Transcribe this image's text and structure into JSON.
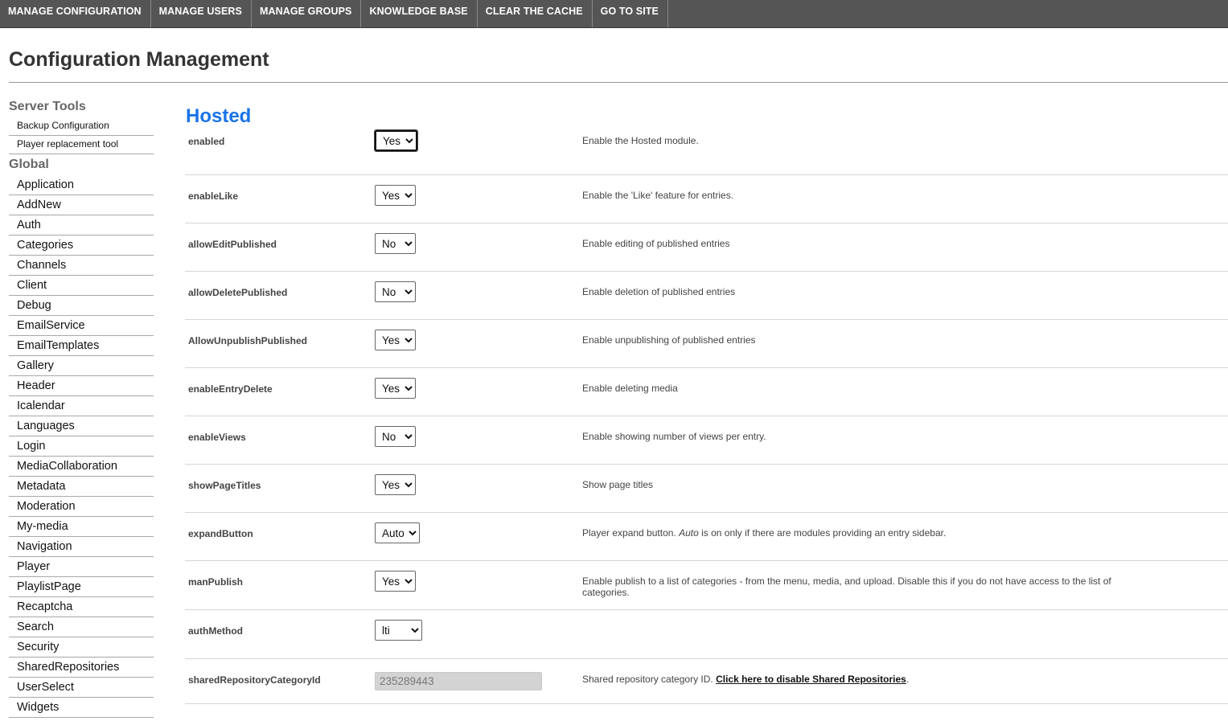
{
  "nav": [
    "MANAGE CONFIGURATION",
    "MANAGE USERS",
    "MANAGE GROUPS",
    "KNOWLEDGE BASE",
    "CLEAR THE CACHE",
    "GO TO SITE"
  ],
  "page": {
    "title": "Configuration Management"
  },
  "sidebar": {
    "server_heading": "Server Tools",
    "server_items": [
      "Backup Configuration",
      "Player replacement tool"
    ],
    "global_heading": "Global",
    "global_items": [
      "Application",
      "AddNew",
      "Auth",
      "Categories",
      "Channels",
      "Client",
      "Debug",
      "EmailService",
      "EmailTemplates",
      "Gallery",
      "Header",
      "Icalendar",
      "Languages",
      "Login",
      "MediaCollaboration",
      "Metadata",
      "Moderation",
      "My-media",
      "Navigation",
      "Player",
      "PlaylistPage",
      "Recaptcha",
      "Search",
      "Security",
      "SharedRepositories",
      "UserSelect",
      "Widgets"
    ]
  },
  "section": {
    "title": "Hosted"
  },
  "settings": [
    {
      "name": "enabled",
      "value": "Yes",
      "desc": "Enable the Hosted module."
    },
    {
      "name": "enableLike",
      "value": "Yes",
      "desc": "Enable the 'Like' feature for entries."
    },
    {
      "name": "allowEditPublished",
      "value": "No",
      "desc": "Enable editing of published entries"
    },
    {
      "name": "allowDeletePublished",
      "value": "No",
      "desc": "Enable deletion of published entries"
    },
    {
      "name": "AllowUnpublishPublished",
      "value": "Yes",
      "desc": "Enable unpublishing of published entries"
    },
    {
      "name": "enableEntryDelete",
      "value": "Yes",
      "desc": "Enable deleting media"
    },
    {
      "name": "enableViews",
      "value": "No",
      "desc": "Enable showing number of views per entry."
    },
    {
      "name": "showPageTitles",
      "value": "Yes",
      "desc": "Show page titles"
    },
    {
      "name": "expandButton",
      "value": "Auto",
      "desc_pre": "Player expand button. ",
      "desc_em": "Auto",
      "desc_post": " is on only if there are modules providing an entry sidebar."
    },
    {
      "name": "manPublish",
      "value": "Yes",
      "desc": "Enable publish to a list of categories - from the menu, media, and upload. Disable this if you do not have access to the list of categories."
    },
    {
      "name": "authMethod",
      "value": "lti",
      "desc": ""
    },
    {
      "name": "sharedRepositoryCategoryId",
      "value": "235289443",
      "desc_pre": "Shared repository category ID. ",
      "link": "Click here to disable Shared Repositories",
      "desc_post": "."
    }
  ]
}
